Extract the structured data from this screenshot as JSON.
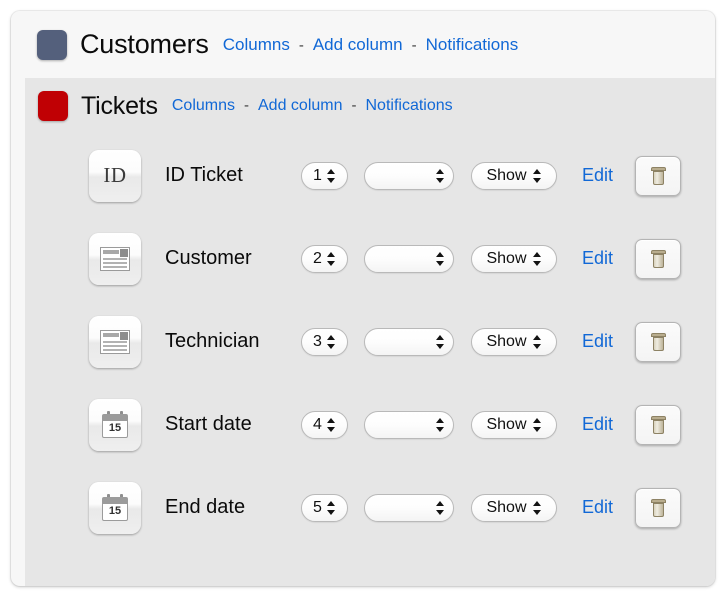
{
  "groups": [
    {
      "name": "Customers",
      "badge_color": "#54607c",
      "badge_icon": "group-badge-icon",
      "links": [
        {
          "label": "Columns",
          "name": "columns-link"
        },
        {
          "label": "Add column",
          "name": "add-column-link"
        },
        {
          "label": "Notifications",
          "name": "notifications-link"
        }
      ],
      "separator": "-"
    },
    {
      "name": "Tickets",
      "badge_color": "#c00004",
      "badge_icon": "group-badge-icon",
      "links": [
        {
          "label": "Columns",
          "name": "columns-link"
        },
        {
          "label": "Add column",
          "name": "add-column-link"
        },
        {
          "label": "Notifications",
          "name": "notifications-link"
        }
      ],
      "separator": "-"
    }
  ],
  "link_color": "#1168d6",
  "row_defaults": {
    "edit_label": "Edit",
    "visibility_value": "Show",
    "type_value": "",
    "delete_icon": "trash-icon"
  },
  "columns": [
    {
      "icon": "id-icon",
      "icon_text": "ID",
      "name": "ID Ticket",
      "order": "1",
      "type": "",
      "visibility": "Show",
      "edit": "Edit"
    },
    {
      "icon": "text-document-icon",
      "icon_text": "",
      "name": "Customer",
      "order": "2",
      "type": "",
      "visibility": "Show",
      "edit": "Edit"
    },
    {
      "icon": "text-document-icon",
      "icon_text": "",
      "name": "Technician",
      "order": "3",
      "type": "",
      "visibility": "Show",
      "edit": "Edit"
    },
    {
      "icon": "calendar-icon",
      "icon_text": "15",
      "name": "Start date",
      "order": "4",
      "type": "",
      "visibility": "Show",
      "edit": "Edit"
    },
    {
      "icon": "calendar-icon",
      "icon_text": "15",
      "name": "End date",
      "order": "5",
      "type": "",
      "visibility": "Show",
      "edit": "Edit"
    }
  ]
}
